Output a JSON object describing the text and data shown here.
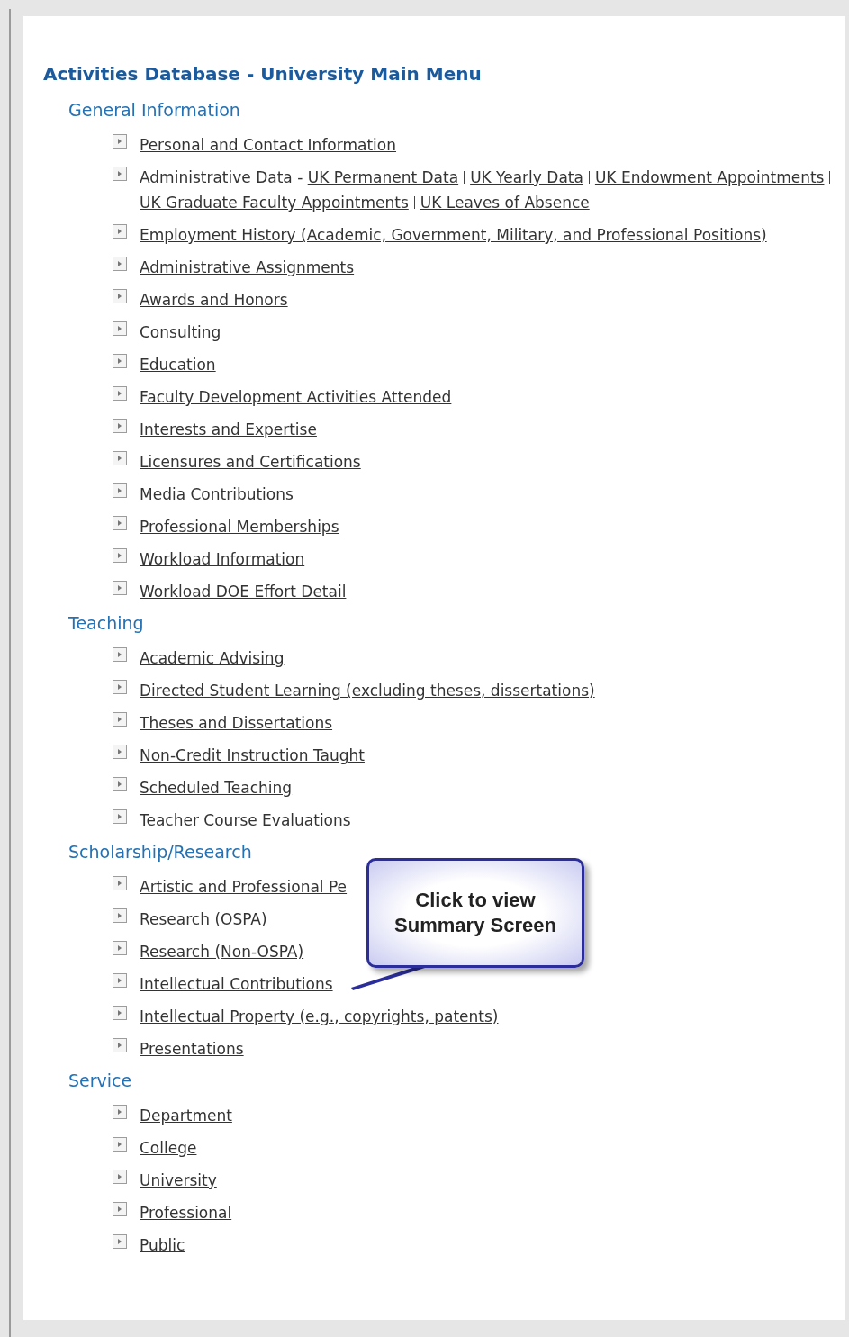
{
  "title": "Activities Database - University Main Menu",
  "sections": [
    {
      "heading": "General Information",
      "items": [
        {
          "kind": "link",
          "label": "Personal and Contact Information"
        },
        {
          "kind": "group",
          "label": "Administrative Data -",
          "links": [
            "UK Permanent Data",
            "UK Yearly Data",
            "UK Endowment Appointments",
            "UK Graduate Faculty Appointments",
            "UK Leaves of Absence"
          ]
        },
        {
          "kind": "link",
          "label": "Employment History (Academic, Government, Military, and Professional Positions)"
        },
        {
          "kind": "link",
          "label": "Administrative Assignments"
        },
        {
          "kind": "link",
          "label": "Awards and Honors"
        },
        {
          "kind": "link",
          "label": "Consulting"
        },
        {
          "kind": "link",
          "label": "Education"
        },
        {
          "kind": "link",
          "label": "Faculty Development Activities Attended"
        },
        {
          "kind": "link",
          "label": "Interests and Expertise"
        },
        {
          "kind": "link",
          "label": "Licensures and Certifications"
        },
        {
          "kind": "link",
          "label": "Media Contributions"
        },
        {
          "kind": "link",
          "label": "Professional Memberships"
        },
        {
          "kind": "link",
          "label": "Workload Information"
        },
        {
          "kind": "link",
          "label": "Workload DOE Effort Detail"
        }
      ]
    },
    {
      "heading": "Teaching",
      "items": [
        {
          "kind": "link",
          "label": "Academic Advising"
        },
        {
          "kind": "link",
          "label": "Directed Student Learning (excluding theses, dissertations)"
        },
        {
          "kind": "link",
          "label": "Theses and Dissertations"
        },
        {
          "kind": "link",
          "label": "Non-Credit Instruction Taught"
        },
        {
          "kind": "link",
          "label": "Scheduled Teaching"
        },
        {
          "kind": "link",
          "label": "Teacher Course Evaluations"
        }
      ]
    },
    {
      "heading": "Scholarship/Research",
      "callout": "Click to view Summary Screen",
      "items": [
        {
          "kind": "link",
          "label": "Artistic and Professional Pe"
        },
        {
          "kind": "link",
          "label": "Research (OSPA)"
        },
        {
          "kind": "link",
          "label": "Research (Non-OSPA)"
        },
        {
          "kind": "link",
          "label": "Intellectual Contributions"
        },
        {
          "kind": "link",
          "label": "Intellectual Property (e.g., copyrights, patents)"
        },
        {
          "kind": "link",
          "label": "Presentations"
        }
      ]
    },
    {
      "heading": "Service",
      "items": [
        {
          "kind": "link",
          "label": "Department"
        },
        {
          "kind": "link",
          "label": "College"
        },
        {
          "kind": "link",
          "label": "University"
        },
        {
          "kind": "link",
          "label": "Professional"
        },
        {
          "kind": "link",
          "label": "Public"
        }
      ]
    }
  ]
}
